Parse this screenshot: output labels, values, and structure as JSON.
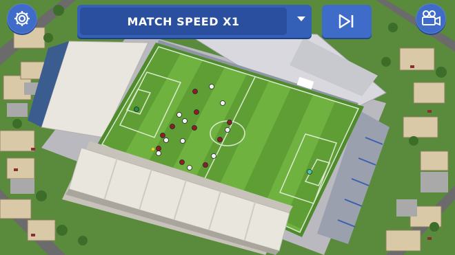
{
  "hud": {
    "speed_label": "MATCH SPEED X1",
    "settings_icon": "gear-icon",
    "dropdown_icon": "caret-down-icon",
    "skip_icon": "skip-forward-icon",
    "camera_icon": "video-camera-icon"
  },
  "colors": {
    "hud_blue": "#3f6cc9",
    "hud_blue_dark": "#2a4f9e",
    "pitch_light": "#6fb23f",
    "pitch_dark": "#5e9e34",
    "home_team": "#8a1f2a",
    "away_team": "#f2f2f2"
  }
}
